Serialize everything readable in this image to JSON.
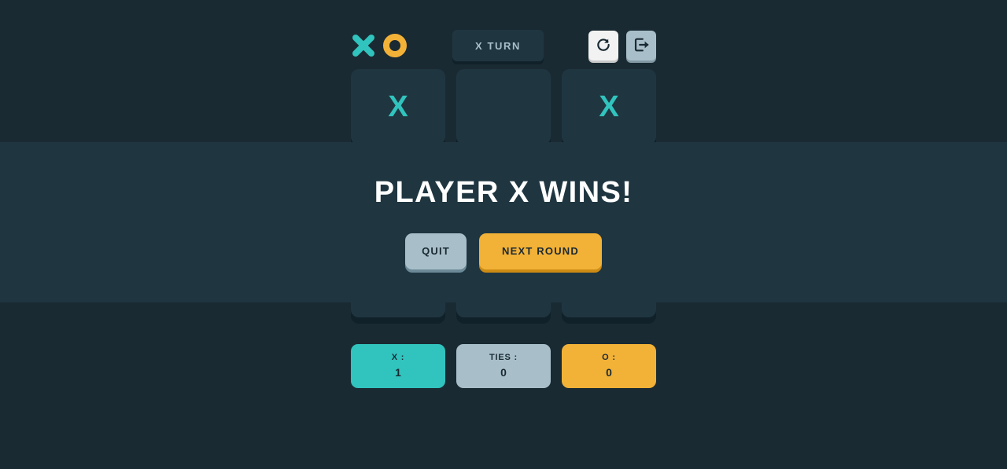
{
  "app": {
    "background_color": "#1A2A33",
    "panel_color": "#1F3641",
    "x_color": "#31C3BD",
    "o_color": "#F2B137",
    "neutral_color": "#A8BFC9"
  },
  "header": {
    "logo": {
      "x_icon": "x-mark-icon",
      "o_icon": "o-mark-icon"
    },
    "turn": {
      "label": "X TURN",
      "icon": "x-mark-small-icon"
    },
    "actions": [
      {
        "name": "restart-button",
        "icon": "restart-icon",
        "title": "Restart"
      },
      {
        "name": "exit-button",
        "icon": "exit-icon",
        "title": "Exit"
      }
    ]
  },
  "board": {
    "cells": [
      {
        "mark": "X"
      },
      {
        "mark": ""
      },
      {
        "mark": "X"
      },
      {
        "mark": ""
      },
      {
        "mark": ""
      },
      {
        "mark": ""
      },
      {
        "mark": ""
      },
      {
        "mark": ""
      },
      {
        "mark": ""
      }
    ]
  },
  "scoreboard": {
    "x": {
      "label": "X :",
      "value": "1"
    },
    "ties": {
      "label": "TIES :",
      "value": "0"
    },
    "o": {
      "label": "O :",
      "value": "0"
    }
  },
  "modal": {
    "title": "PLAYER X WINS!",
    "quit_label": "QUIT",
    "next_round_label": "NEXT ROUND"
  }
}
